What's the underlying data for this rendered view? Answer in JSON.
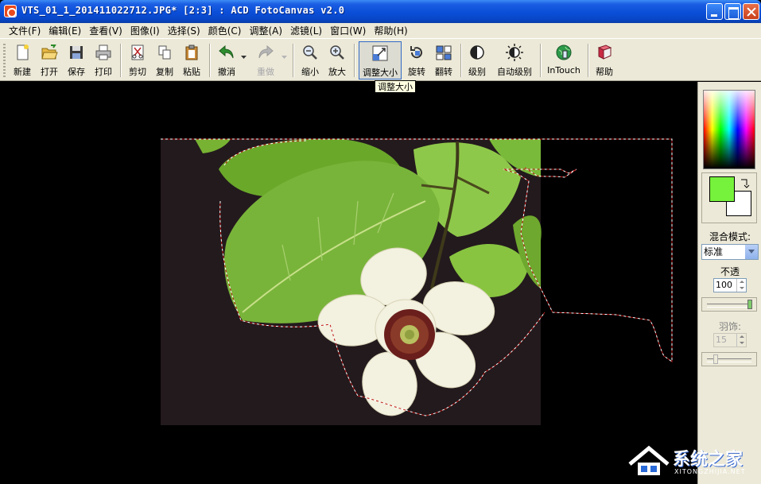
{
  "window": {
    "title": "VTS_01_1_201411022712.JPG* [2:3] : ACD FotoCanvas v2.0"
  },
  "menu": [
    "文件(F)",
    "编辑(E)",
    "查看(V)",
    "图像(I)",
    "选择(S)",
    "颜色(C)",
    "调整(A)",
    "滤镜(L)",
    "窗口(W)",
    "帮助(H)"
  ],
  "toolbar": {
    "new": "新建",
    "open": "打开",
    "save": "保存",
    "print": "打印",
    "cut": "剪切",
    "copy": "复制",
    "paste": "粘贴",
    "undo": "撤消",
    "redo": "重做",
    "zoom_out": "缩小",
    "zoom_in": "放大",
    "resize": "调整大小",
    "rotate": "旋转",
    "flip": "翻转",
    "levels": "级别",
    "auto_levels": "自动级别",
    "intouch": "InTouch",
    "help": "帮助"
  },
  "tooltip": "调整大小",
  "panel": {
    "fg_color": "#77f23c",
    "bg_color": "#ffffff",
    "blend_label": "混合模式:",
    "blend_value": "标准",
    "opacity_label": "不透",
    "opacity_value": "100",
    "opacity_level": 1.0,
    "feather_label": "羽饰:",
    "feather_value": "15"
  },
  "watermark": {
    "text": "系统之家",
    "sub": "XITONGZHIJIA.NET"
  }
}
